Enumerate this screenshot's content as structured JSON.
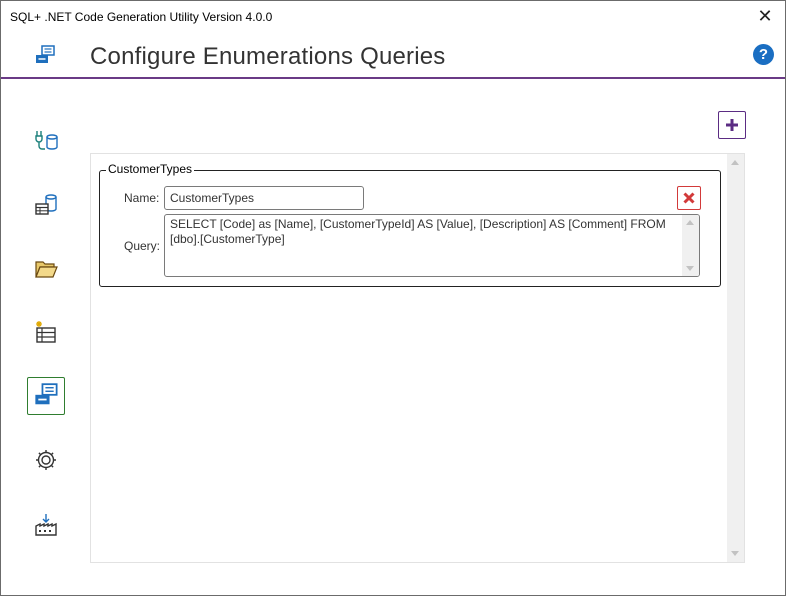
{
  "window": {
    "title": "SQL+ .NET Code Generation Utility Version 4.0.0",
    "close_glyph": "✕"
  },
  "header": {
    "title": "Configure Enumerations Queries",
    "icon": "enumeration-icon",
    "help_glyph": "?"
  },
  "nav": {
    "items": [
      {
        "icon": "connection-database-icon",
        "active": false
      },
      {
        "icon": "database-table-icon",
        "active": false
      },
      {
        "icon": "folder-open-icon",
        "active": false
      },
      {
        "icon": "new-list-icon",
        "active": false
      },
      {
        "icon": "enumeration-icon",
        "active": true
      },
      {
        "icon": "gear-icon",
        "active": false
      },
      {
        "icon": "download-build-icon",
        "active": false
      }
    ]
  },
  "colors": {
    "accent": "#6a3a86",
    "active_border": "#2f7d2f",
    "delete": "#d23a3a",
    "help": "#1a6ec2",
    "icon_blue": "#1f6fbd"
  },
  "queries": [
    {
      "group_label": "CustomerTypes",
      "name_label": "Name:",
      "name_value": "CustomerTypes",
      "query_label": "Query:",
      "query_value": "SELECT [Code] as [Name], [CustomerTypeId] AS [Value], [Description] AS [Comment] FROM [dbo].[CustomerType]"
    }
  ]
}
